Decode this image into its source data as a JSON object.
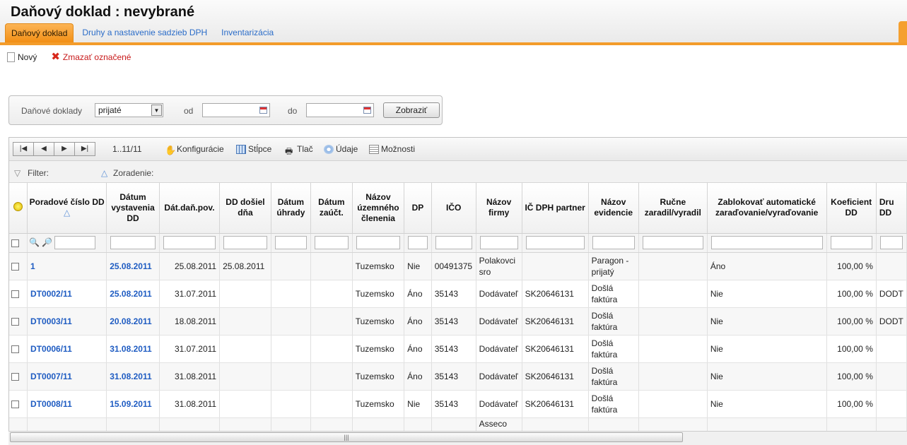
{
  "title": "Daňový doklad :  nevybrané",
  "tabs": [
    {
      "label": "Daňový doklad",
      "active": true
    },
    {
      "label": "Druhy a nastavenie sadzieb DPH",
      "active": false
    },
    {
      "label": "Inventarizácia",
      "active": false
    }
  ],
  "toolbar": {
    "new_label": "Nový",
    "delete_label": "Zmazať označené"
  },
  "filter": {
    "type_label": "Daňové doklady",
    "type_value": "prijaté",
    "from_label": "od",
    "to_label": "do",
    "show_label": "Zobraziť"
  },
  "grid_toolbar": {
    "range": "1..11/11",
    "config": "Konfigurácie",
    "columns": "Stĺpce",
    "print": "Tlač",
    "data": "Údaje",
    "options": "Možnosti"
  },
  "filter_bar": {
    "filter_label": "Filter:",
    "sort_label": "Zoradenie:"
  },
  "columns": [
    "Poradové číslo DD",
    "Dátum vystavenia DD",
    "Dát.daň.pov.",
    "DD došiel dňa",
    "Dátum úhrady",
    "Dátum zaúčt.",
    "Názov územného členenia",
    "DP",
    "IČO",
    "Názov firmy",
    "IČ DPH partner",
    "Názov evidencie",
    "Ručne zaradil/vyradil",
    "Zablokovať automatické zaraďovanie/vyraďovanie",
    "Koeficient DD",
    "Dru DD"
  ],
  "rows": [
    [
      "1",
      "25.08.2011",
      "25.08.2011",
      "25.08.2011",
      "",
      "",
      "Tuzemsko",
      "Nie",
      "00491375",
      "Polakovci sro",
      "",
      "Paragon - prijatý",
      "",
      "Áno",
      "100,00 %",
      ""
    ],
    [
      "DT0002/11",
      "25.08.2011",
      "31.07.2011",
      "",
      "",
      "",
      "Tuzemsko",
      "Áno",
      "35143",
      "Dodávateľ",
      "SK20646131",
      "Došlá faktúra",
      "",
      "Nie",
      "100,00 %",
      "DODT"
    ],
    [
      "DT0003/11",
      "20.08.2011",
      "18.08.2011",
      "",
      "",
      "",
      "Tuzemsko",
      "Áno",
      "35143",
      "Dodávateľ",
      "SK20646131",
      "Došlá faktúra",
      "",
      "Nie",
      "100,00 %",
      "DODT"
    ],
    [
      "DT0006/11",
      "31.08.2011",
      "31.07.2011",
      "",
      "",
      "",
      "Tuzemsko",
      "Áno",
      "35143",
      "Dodávateľ",
      "SK20646131",
      "Došlá faktúra",
      "",
      "Nie",
      "100,00 %",
      ""
    ],
    [
      "DT0007/11",
      "31.08.2011",
      "31.08.2011",
      "",
      "",
      "",
      "Tuzemsko",
      "Áno",
      "35143",
      "Dodávateľ",
      "SK20646131",
      "Došlá faktúra",
      "",
      "Nie",
      "100,00 %",
      ""
    ],
    [
      "DT0008/11",
      "15.09.2011",
      "31.08.2011",
      "",
      "",
      "",
      "Tuzemsko",
      "Nie",
      "35143",
      "Dodávateľ",
      "SK20646131",
      "Došlá faktúra",
      "",
      "Nie",
      "100,00 %",
      ""
    ],
    [
      "",
      "",
      "",
      "",
      "",
      "",
      "",
      "",
      "",
      "Asseco",
      "",
      "",
      "",
      "",
      "",
      ""
    ]
  ],
  "colors": {
    "accent": "#f39c2b",
    "link": "#1f5cc2",
    "delete": "#c8191a"
  }
}
